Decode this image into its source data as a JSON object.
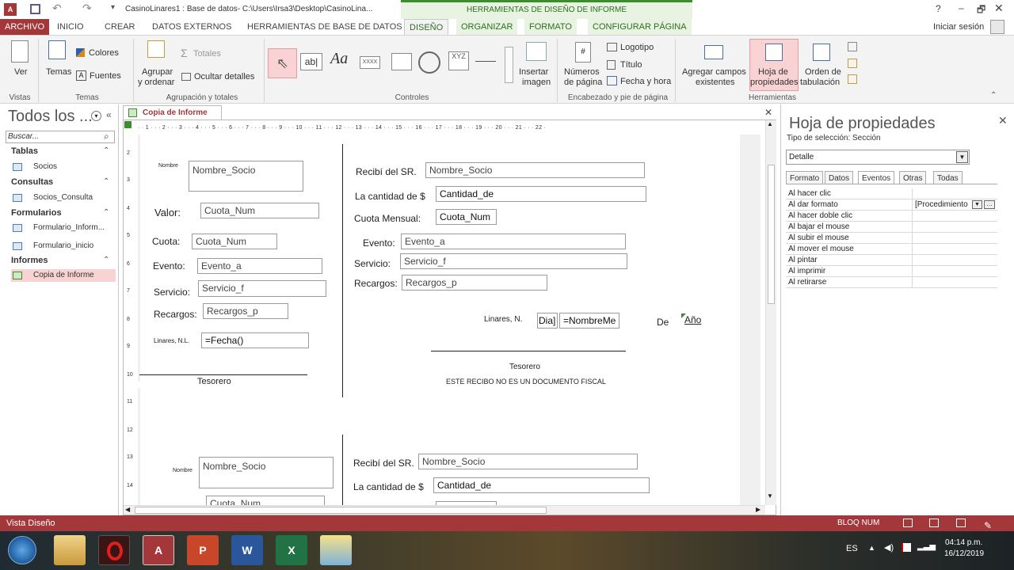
{
  "window": {
    "title": "CasinoLinares1 : Base de datos- C:\\Users\\Irsa3\\Desktop\\CasinoLina...",
    "contextual_group": "HERRAMIENTAS DE DISEÑO DE INFORME",
    "help": "?",
    "minimize": "–",
    "restore": "🗗",
    "close": "✕",
    "signin": "Iniciar sesión"
  },
  "tabs": [
    "ARCHIVO",
    "INICIO",
    "CREAR",
    "DATOS EXTERNOS",
    "HERRAMIENTAS DE BASE DE DATOS",
    "DISEÑO",
    "ORGANIZAR",
    "FORMATO",
    "CONFIGURAR PÁGINA"
  ],
  "ribbon": {
    "ver": "Ver",
    "temas": "Temas",
    "colores": "Colores",
    "fuentes": "Fuentes",
    "agrupar": "Agrupar",
    "y_ordenar": "y ordenar",
    "totales": "Totales",
    "ocultar": "Ocultar detalles",
    "insertar": "Insertar",
    "imagen": "imagen",
    "numeros": "Números",
    "de_pagina": "de página",
    "logotipo": "Logotipo",
    "titulo": "Título",
    "fecha": "Fecha y hora",
    "agregar": "Agregar campos",
    "existentes": "existentes",
    "hoja": "Hoja de",
    "propiedades": "propiedades",
    "orden": "Orden de",
    "tabulacion": "tabulación",
    "groups": {
      "vistas": "Vistas",
      "temas": "Temas",
      "agrupacion": "Agrupación y totales",
      "controles": "Controles",
      "encabezado": "Encabezado y pie de página",
      "herramientas": "Herramientas"
    }
  },
  "nav": {
    "title": "Todos los ...",
    "search_placeholder": "Buscar...",
    "sections": [
      {
        "name": "Tablas",
        "items": [
          "Socios"
        ]
      },
      {
        "name": "Consultas",
        "items": [
          "Socios_Consulta"
        ]
      },
      {
        "name": "Formularios",
        "items": [
          "Formulario_Inform...",
          "Formulario_inicio"
        ]
      },
      {
        "name": "Informes",
        "items": [
          "Copia de Informe"
        ]
      }
    ]
  },
  "document_tab": "Copia de Informe",
  "ruler_h": "· · 1 · · · 2 · · · 3 · · · 4 · · · 5 · · · 6 · · · 7 · · · 8 · · · 9 · · · 10 · · · 11 · · · 12 · · · 13 · · · 14 · · · 15 · · · 16 · · · 17 · · · 18 · · · 19 · · · 20 · · · 21 · · · 22 ·",
  "ruler_v": [
    "2",
    "3",
    "4",
    "5",
    "6",
    "7",
    "8",
    "9",
    "10",
    "11",
    "12",
    "13",
    "14"
  ],
  "report": {
    "left": {
      "nombre_lbl": "Nombre",
      "nombre_fld": "Nombre_Socio",
      "valor_lbl": "Valor:",
      "valor_fld": "Cuota_Num",
      "cuota_lbl": "Cuota:",
      "cuota_fld": "Cuota_Num",
      "evento_lbl": "Evento:",
      "evento_fld": "Evento_a",
      "servicio_lbl": "Servicio:",
      "servicio_fld": "Servicio_f",
      "recargos_lbl": "Recargos:",
      "recargos_fld": "Recargos_p",
      "linares_lbl": "Linares, N.L.",
      "fecha_fld": "=Fecha()",
      "tesorero": "Tesorero"
    },
    "right": {
      "recibi_lbl": "Recibí del SR.",
      "recibi_fld": "Nombre_Socio",
      "cantidad_lbl": "La cantidad de $",
      "cantidad_fld": "Cantidad_de",
      "cuota_lbl": "Cuota Mensual:",
      "cuota_fld": "Cuota_Num",
      "evento_lbl": "Evento:",
      "evento_fld": "Evento_a",
      "servicio_lbl": "Servicio:",
      "servicio_fld": "Servicio_f",
      "recargos_lbl": "Recargos:",
      "recargos_fld": "Recargos_p",
      "linares_lbl": "Linares, N.",
      "dia_fld": "Dia]",
      "mes_fld": "=NombreMe",
      "de_lbl": "De",
      "anio_lbl": "Año",
      "tesorero": "Tesorero",
      "fiscal": "ESTE RECIBO  NO ES UN DOCUMENTO FISCAL"
    },
    "second": {
      "nombre_lbl": "Nombre",
      "nombre_fld": "Nombre_Socio",
      "cuota_fld": "Cuota_Num",
      "recibi_lbl": "Recibí del SR.",
      "recibi_fld": "Nombre_Socio",
      "cantidad_lbl": "La cantidad de $",
      "cantidad_fld": "Cantidad_de"
    }
  },
  "props": {
    "title": "Hoja de propiedades",
    "sel_type": "Tipo de selección:  Sección",
    "selection": "Detalle",
    "tabs": [
      "Formato",
      "Datos",
      "Eventos",
      "Otras",
      "Todas"
    ],
    "rows": [
      {
        "k": "Al hacer clic",
        "v": ""
      },
      {
        "k": "Al dar formato",
        "v": "[Procedimiento"
      },
      {
        "k": "Al hacer doble clic",
        "v": ""
      },
      {
        "k": "Al bajar el mouse",
        "v": ""
      },
      {
        "k": "Al subir el mouse",
        "v": ""
      },
      {
        "k": "Al mover el mouse",
        "v": ""
      },
      {
        "k": "Al pintar",
        "v": ""
      },
      {
        "k": "Al imprimir",
        "v": ""
      },
      {
        "k": "Al retirarse",
        "v": ""
      }
    ]
  },
  "status": {
    "left": "Vista Diseño",
    "bloq": "BLOQ NUM"
  },
  "taskbar": {
    "lang": "ES",
    "time": "04:14 p.m.",
    "date": "16/12/2019"
  }
}
